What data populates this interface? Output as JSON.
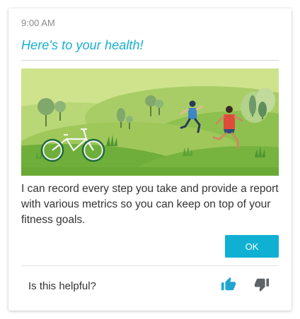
{
  "card": {
    "timestamp": "9:00 AM",
    "headline": "Here's to your health!",
    "illustration_icon": "fitness-park-illustration",
    "body": "I can record every step you take and provide a report with various metrics so you can keep on top of your fitness goals.",
    "ok_label": "OK"
  },
  "feedback": {
    "question": "Is this helpful?",
    "thumbs_up_icon": "thumbs-up-icon",
    "thumbs_down_icon": "thumbs-down-icon"
  },
  "colors": {
    "accent": "#18aed2",
    "button": "#10b0d3",
    "thumbs_up": "#1fa6d0",
    "thumbs_down": "#5f6368"
  }
}
